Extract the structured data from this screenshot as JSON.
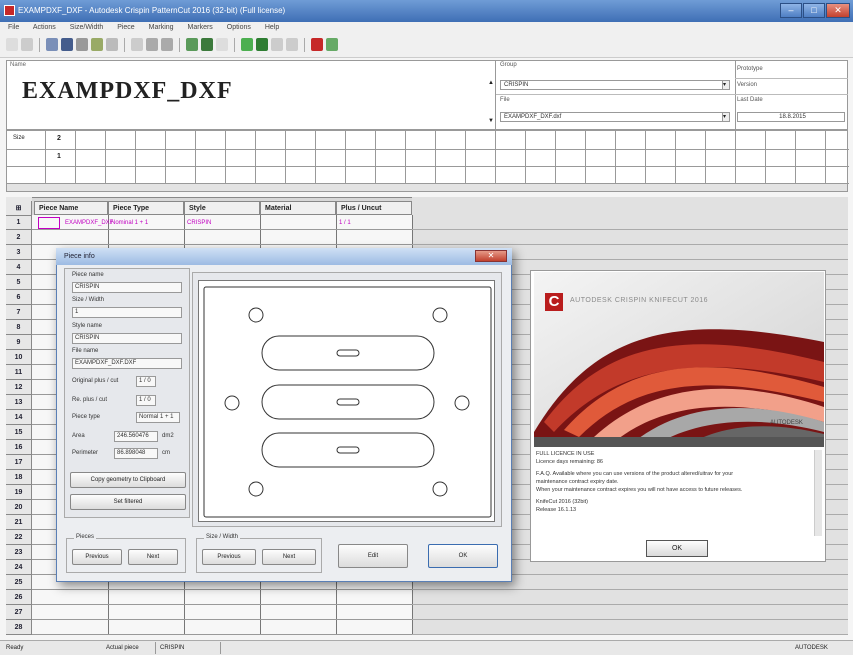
{
  "app": {
    "title": "EXAMPDXF_DXF - Autodesk Crispin PatternCut 2016 (32-bit) (Full license)",
    "menu": [
      "File",
      "Actions",
      "Size/Width",
      "Piece",
      "Marking",
      "Markers",
      "Options",
      "Help"
    ]
  },
  "header": {
    "name_label": "Name",
    "model_name": "EXAMPDXF_DXF",
    "group_label": "Group",
    "group_value": "CRISPIN",
    "file_label": "File",
    "file_value": "EXAMPDXF_DXF.dxf",
    "prototype_label": "Prototype",
    "prototype_value": "Version",
    "date_label": "Last Date",
    "date_value": "18.8.2015"
  },
  "grid": {
    "size_label": "Size",
    "col1": "2",
    "row1": "1"
  },
  "table": {
    "headers": [
      "Piece Name",
      "Piece Type",
      "Style",
      "Material",
      "Plus / Uncut"
    ],
    "row1": [
      "EXAMPDXF_DXF",
      "Nominal 1 + 1",
      "CRISPIN",
      "",
      "1 / 1"
    ],
    "row_numbers": [
      "1",
      "2",
      "3",
      "4",
      "5",
      "6",
      "7",
      "8",
      "9",
      "10",
      "11",
      "12",
      "13",
      "14",
      "15",
      "16",
      "17",
      "18",
      "19",
      "20",
      "21",
      "22",
      "23",
      "24",
      "25",
      "26",
      "27",
      "28"
    ]
  },
  "dialog": {
    "title": "Piece info",
    "close": "✕",
    "piece_name_label": "Piece name",
    "piece_name_value": "CRISPIN",
    "size_label": "Size / Width",
    "size_value": "1",
    "style_label": "Style name",
    "style_value": "CRISPIN",
    "file_label": "File name",
    "file_value": "EXAMPDXF_DXF.DXF",
    "orig_label": "Original plus / cut",
    "orig_value": "1 / 0",
    "re_label": "Re. plus / cut",
    "re_value": "1 / 0",
    "piecetype_label": "Piece type",
    "piecetype_value": "Normal 1 + 1",
    "area_label": "Area",
    "area_value": "246.560476",
    "area_unit": "dm2",
    "perim_label": "Perimeter",
    "perim_value": "86.898048",
    "perim_unit": "cm",
    "copy_btn": "Copy geometry to Clipboard",
    "set_btn": "Set filtered",
    "pieces_group": "Pieces",
    "size_group": "Size / Width",
    "prev": "Previous",
    "next": "Next",
    "edit": "Edit",
    "ok": "OK"
  },
  "splash": {
    "logo_letter": "C",
    "title": "AUTODESK CRISPIN KNIFECUT 2016",
    "brand": "AUTODESK",
    "license": "FULL LICENCE IN USE",
    "days": "Licence days remaining: 86",
    "info1": "F.A.Q. Available where you can use versions of the product altered/uitrav for your",
    "info2": "maintenance contract expiry date.",
    "info3": "When your maintenance contract expires you will not have access to future releases.",
    "version1": "KnifeCut 2016 (32bit)",
    "version2": "Release 16.1.13",
    "ok": "OK"
  },
  "status": {
    "left": "Ready",
    "mid_label": "Actual piece",
    "mid_value": "CRISPIN",
    "right": "AUTODESK"
  },
  "colors": {
    "titlebar": "#3f6fb5",
    "magenta": "#c200c2",
    "autodesk_red": "#b91d1d"
  }
}
